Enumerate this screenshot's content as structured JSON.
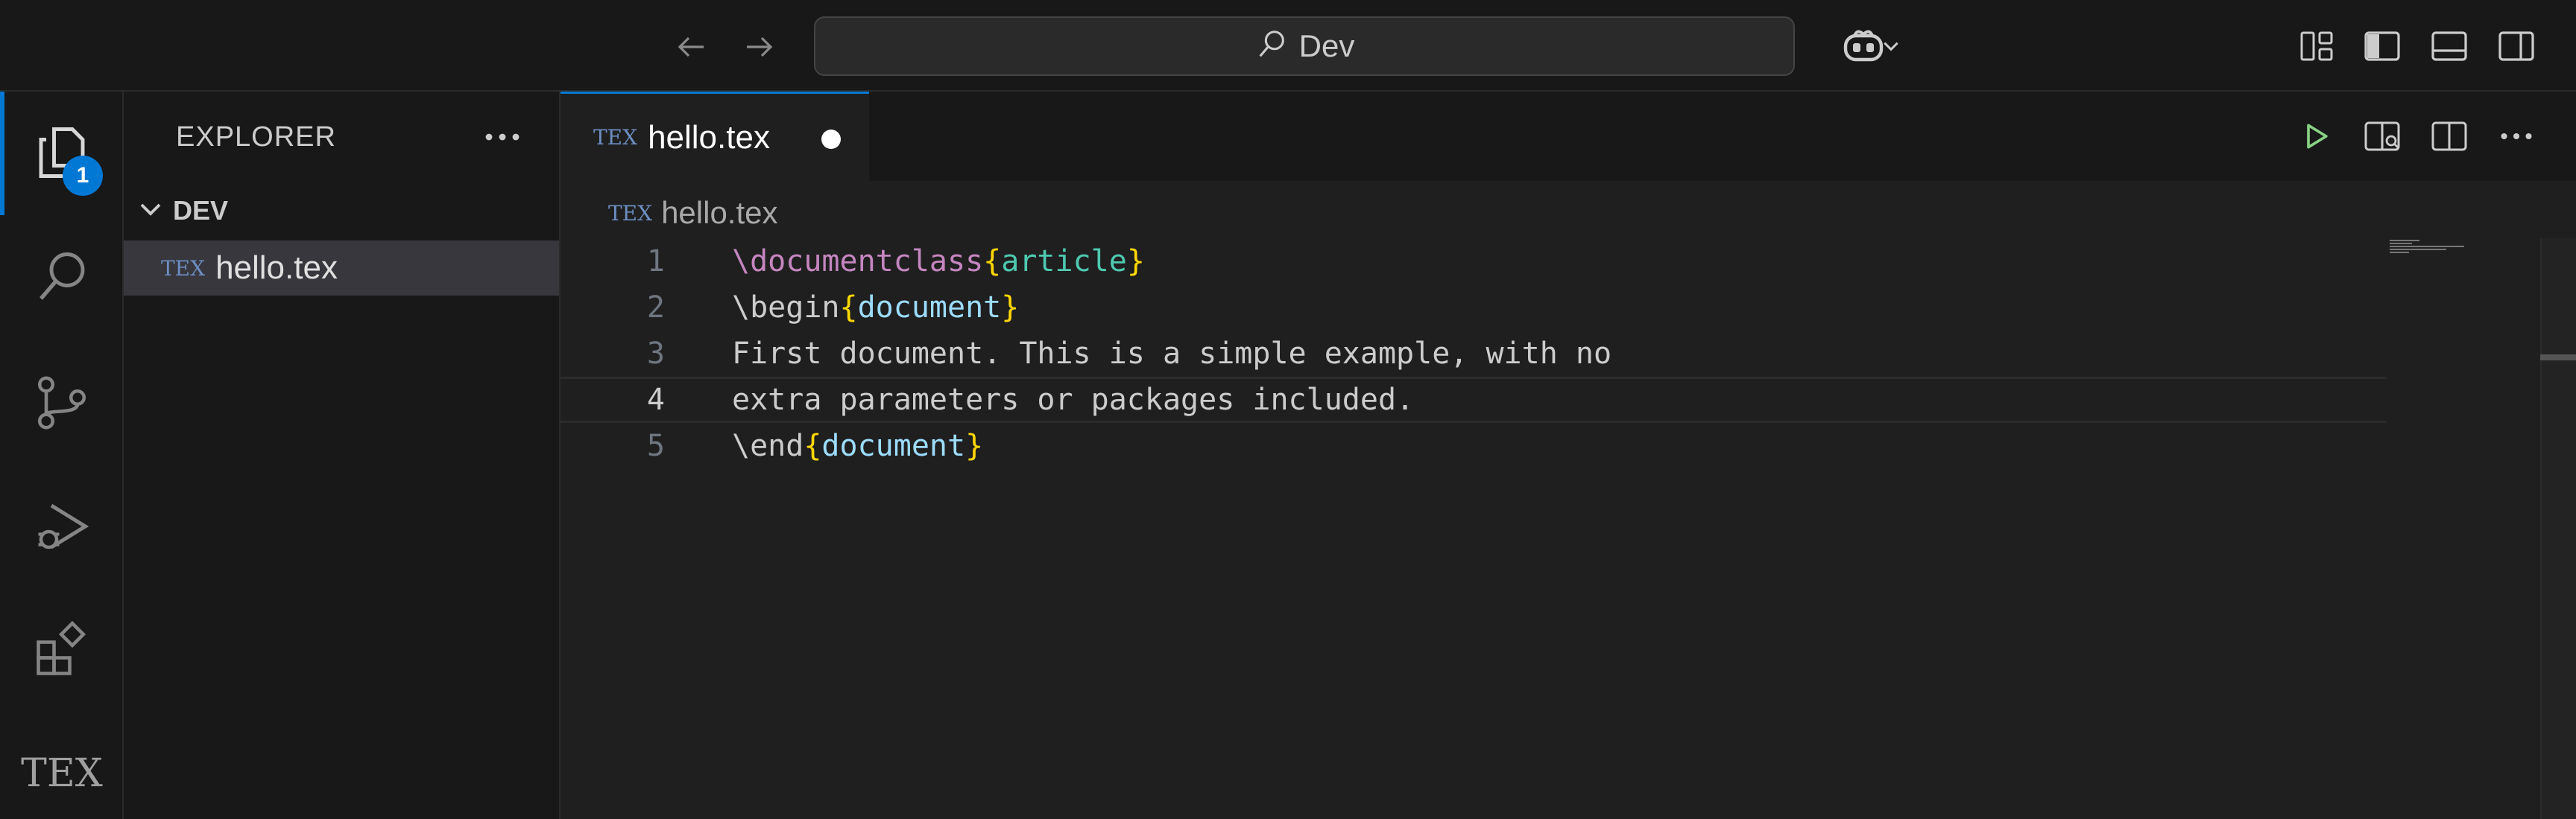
{
  "titlebar": {
    "search_text": "Dev",
    "icons": [
      "arrow-left-icon",
      "arrow-right-icon",
      "search-icon",
      "copilot-icon",
      "chevron-down-icon",
      "customize-layout-icon",
      "toggle-sidebar-icon",
      "toggle-panel-icon",
      "toggle-secondary-sidebar-icon"
    ]
  },
  "activitybar": {
    "items": [
      "explorer",
      "search",
      "source-control",
      "run-and-debug",
      "extensions",
      "tex"
    ],
    "explorer_badge": "1",
    "tex_label": "TEX"
  },
  "sidebar": {
    "title": "EXPLORER",
    "folder": "DEV",
    "files": [
      {
        "name": "hello.tex",
        "icon": "TEX"
      }
    ]
  },
  "tab": {
    "label": "hello.tex",
    "icon": "TEX",
    "dirty": true
  },
  "breadcrumb": {
    "label": "hello.tex",
    "icon": "TEX"
  },
  "editor": {
    "current_line": 4,
    "lines": [
      {
        "num": "1",
        "p1": "\\documentclass",
        "p2": "{",
        "p3": "article",
        "p4": "}"
      },
      {
        "num": "2",
        "p1": "\\begin",
        "p2": "{",
        "p3": "document",
        "p4": "}"
      },
      {
        "num": "3",
        "text": "First document. This is a simple example, with no"
      },
      {
        "num": "4",
        "text": "extra parameters or packages included."
      },
      {
        "num": "5",
        "p1": "\\end",
        "p2": "{",
        "p3": "document",
        "p4": "}"
      }
    ]
  },
  "colors": {
    "accent": "#0078d4",
    "keyword": "#c586c0",
    "bracket": "#ffd700",
    "run_icon": "#89d185"
  }
}
